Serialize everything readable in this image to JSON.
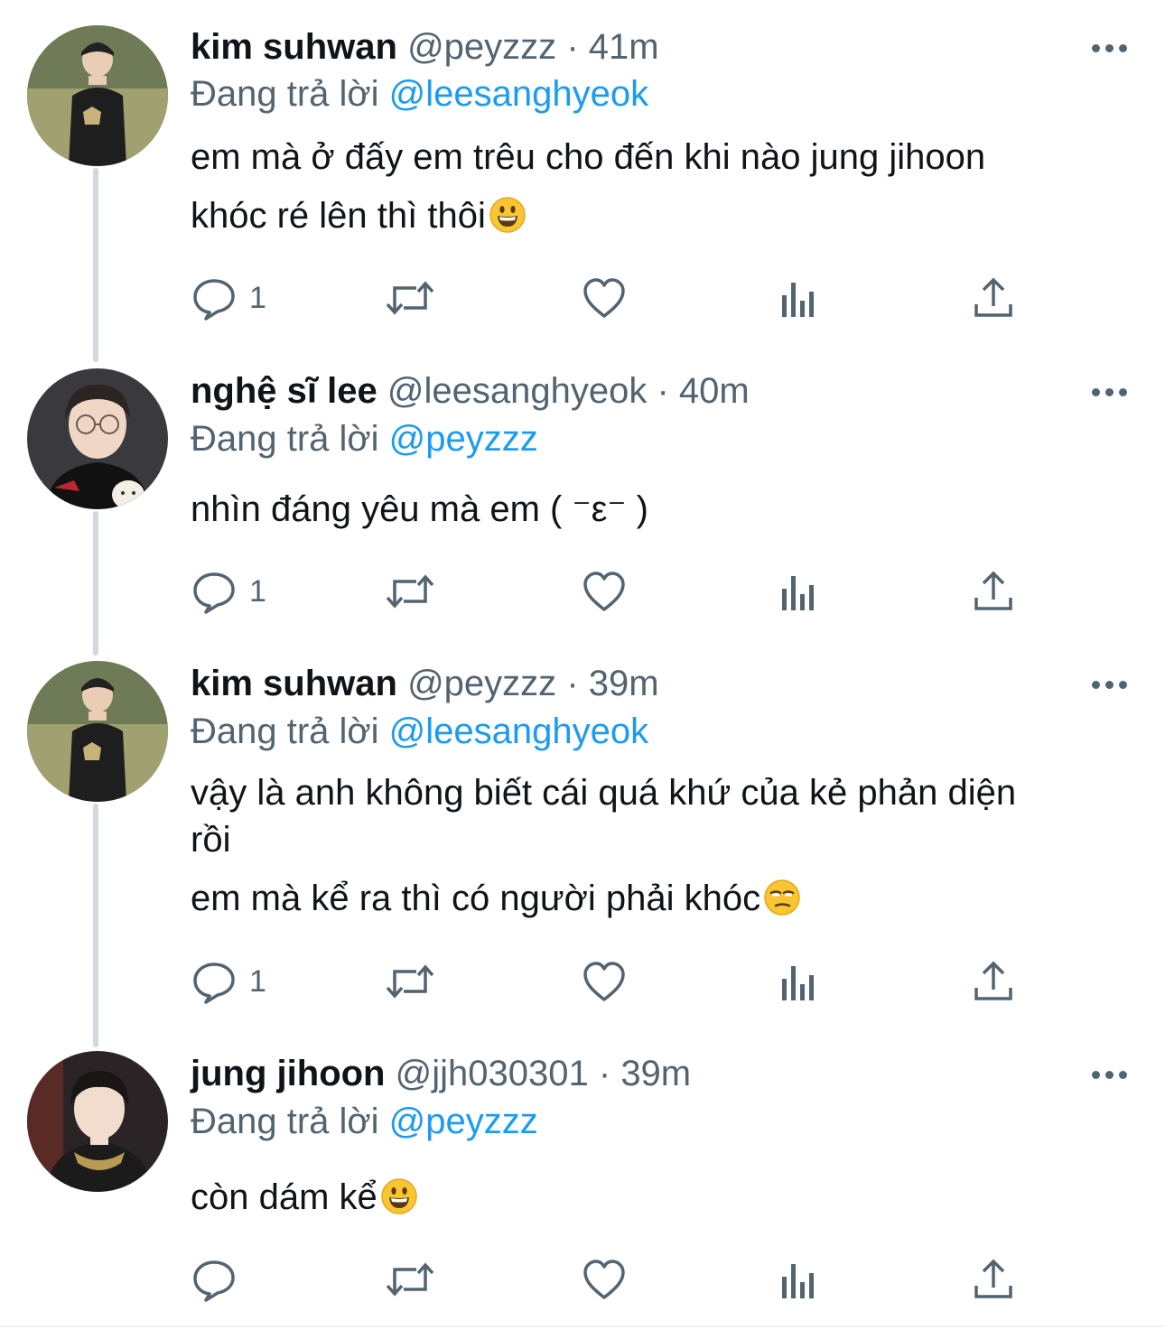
{
  "tweets": [
    {
      "name": "kim suhwan",
      "handle": "@peyzzz",
      "dot": "·",
      "time": "41m",
      "replying_prefix": "Đang trả lời",
      "replying_to": "@leesanghyeok",
      "lines": [
        "em mà ở đấy em trêu cho đến khi nào jung jihoon",
        "khóc ré lên thì thôi"
      ],
      "reply_count": "1"
    },
    {
      "name": "nghệ sĩ lee",
      "handle": "@leesanghyeok",
      "dot": "·",
      "time": "40m",
      "replying_prefix": "Đang trả lời",
      "replying_to": "@peyzzz",
      "lines": [
        "nhìn đáng yêu mà em ( ⁻ε⁻ )"
      ],
      "reply_count": "1"
    },
    {
      "name": "kim suhwan",
      "handle": "@peyzzz",
      "dot": "·",
      "time": "39m",
      "replying_prefix": "Đang trả lời",
      "replying_to": "@leesanghyeok",
      "lines": [
        "vậy là anh không biết cái quá khứ của kẻ phản diện",
        "rồi",
        "em mà kể ra thì có người phải khóc"
      ],
      "reply_count": "1"
    },
    {
      "name": "jung jihoon",
      "handle": "@jjh030301",
      "dot": "·",
      "time": "39m",
      "replying_prefix": "Đang trả lời",
      "replying_to": "@peyzzz",
      "lines": [
        "còn dám kể"
      ],
      "reply_count": ""
    }
  ],
  "icons": {
    "reply": "reply-icon",
    "retweet": "retweet-icon",
    "like": "heart-icon",
    "views": "views-icon",
    "share": "share-icon",
    "more": "more-icon",
    "grin_emoji": "grinning-emoji",
    "unamused_emoji": "unamused-emoji"
  },
  "colors": {
    "text": "#0f1419",
    "secondary": "#536471",
    "mention": "#1d9bf0",
    "thread_line": "#cfd9de"
  }
}
